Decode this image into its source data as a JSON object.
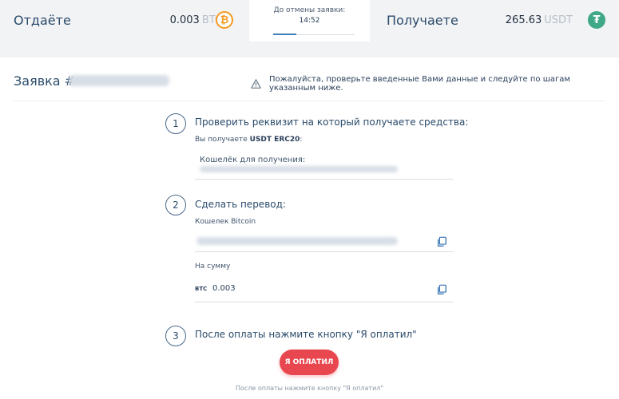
{
  "header": {
    "give": {
      "label": "Отдаёте",
      "amount": "0.003",
      "currency": "BTC",
      "coin_icon": "bitcoin-icon",
      "coin_color": "#f39a1e"
    },
    "timer": {
      "label": "До отмены заявки:",
      "value": "14:52",
      "progress": 0.28
    },
    "receive": {
      "label": "Получаете",
      "amount": "265.63",
      "currency": "USDT",
      "coin_icon": "tether-icon",
      "coin_color": "#3fa886"
    }
  },
  "order": {
    "title_prefix": "Заявка #",
    "notice": "Пожалуйста, проверьте введенные Вами данные и следуйте по шагам указанным ниже."
  },
  "steps": [
    {
      "number": "1",
      "title": "Проверить реквизит на который получаете средства:",
      "receive_prefix": "Вы получаете",
      "receive_network": "USDT ERC20",
      "receive_suffix": ":",
      "wallet_label": "Кошелёк для получения:"
    },
    {
      "number": "2",
      "title": "Сделать перевод:",
      "wallet_label": "Кошелек Bitcoin",
      "sum_label": "На сумму",
      "sum_currency": "BTC",
      "sum_value": "0.003"
    },
    {
      "number": "3",
      "title": "После оплаты нажмите кнопку \"Я оплатил\""
    }
  ],
  "pay_button": {
    "label": "Я ОПЛАТИЛ",
    "color": "#e8474f"
  },
  "footer_note": "После оплаты нажмите кнопку \"Я оплатил\""
}
